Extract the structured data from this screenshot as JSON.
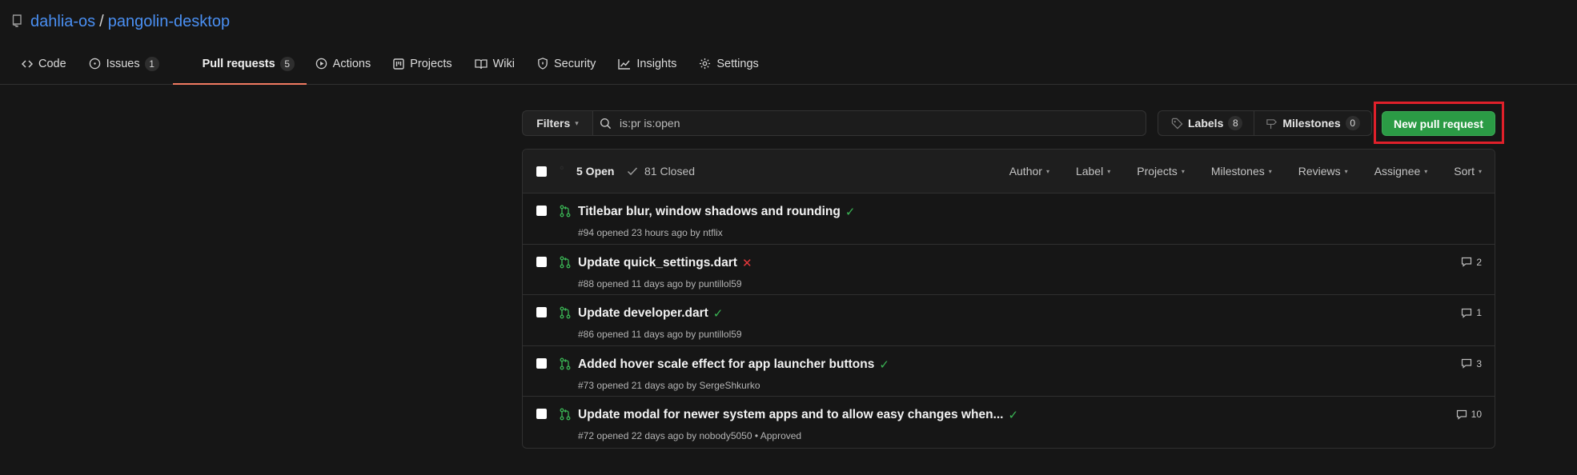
{
  "repo": {
    "owner": "dahlia-os",
    "separator": "/",
    "name": "pangolin-desktop"
  },
  "nav": {
    "code": "Code",
    "issues": "Issues",
    "issues_count": "1",
    "pulls": "Pull requests",
    "pulls_count": "5",
    "actions": "Actions",
    "projects": "Projects",
    "wiki": "Wiki",
    "security": "Security",
    "insights": "Insights",
    "settings": "Settings"
  },
  "toolbar": {
    "filters": "Filters",
    "search_value": "is:pr is:open",
    "labels": "Labels",
    "labels_count": "8",
    "milestones": "Milestones",
    "milestones_count": "0",
    "new_pr": "New pull request"
  },
  "list": {
    "open": "5 Open",
    "closed": "81 Closed",
    "filters": [
      "Author",
      "Label",
      "Projects",
      "Milestones",
      "Reviews",
      "Assignee",
      "Sort"
    ]
  },
  "prs": [
    {
      "title": "Titlebar blur, window shadows and rounding",
      "status": "ok",
      "status_glyph": "✓",
      "meta": "#94 opened 23 hours ago by ntflix",
      "comments": ""
    },
    {
      "title": "Update quick_settings.dart",
      "status": "fail",
      "status_glyph": "✕",
      "meta": "#88 opened 11 days ago by puntillol59",
      "comments": "2"
    },
    {
      "title": "Update developer.dart",
      "status": "ok",
      "status_glyph": "✓",
      "meta": "#86 opened 11 days ago by puntillol59",
      "comments": "1"
    },
    {
      "title": "Added hover scale effect for app launcher buttons",
      "status": "ok",
      "status_glyph": "✓",
      "meta": "#73 opened 21 days ago by SergeShkurko",
      "comments": "3"
    },
    {
      "title": "Update modal for newer system apps and to allow easy changes when...",
      "status": "ok",
      "status_glyph": "✓",
      "meta": "#72 opened 22 days ago by nobody5050 • Approved",
      "comments": "10"
    }
  ],
  "colors": {
    "accent_link": "#4a8ff2",
    "tab_underline": "#f07a61",
    "new_pr_bg": "#2b9b45",
    "highlight_box": "#e0202a",
    "ok": "#3ab454",
    "fail": "#e5383b"
  },
  "icons": {
    "repo": "repo-icon",
    "code": "code-icon",
    "issues": "issue-icon",
    "actions": "play-icon",
    "projects": "project-icon",
    "wiki": "book-icon",
    "security": "shield-icon",
    "insights": "graph-icon",
    "settings": "gear-icon",
    "search": "search-icon",
    "labels": "tag-icon",
    "milestones": "milestone-icon",
    "open_pr": "git-pull-request-icon",
    "closed": "check-icon",
    "comment": "comment-icon"
  }
}
